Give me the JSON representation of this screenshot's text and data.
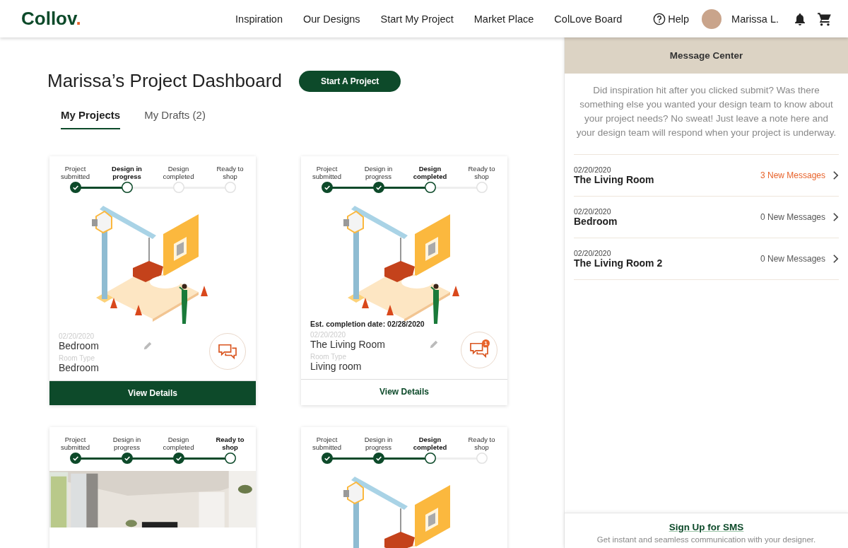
{
  "header": {
    "logo": {
      "text": "Collov",
      "dot": "."
    },
    "nav": [
      "Inspiration",
      "Our Designs",
      "Start My Project",
      "Market Place",
      "ColLove Board"
    ],
    "help": "Help",
    "user": "Marissa L."
  },
  "dashboard": {
    "title": "Marissa’s Project Dashboard",
    "start_button": "Start A Project",
    "tabs": [
      {
        "label": "My Projects",
        "selected": true
      },
      {
        "label": "My Drafts (2)",
        "selected": false
      }
    ],
    "projects": [
      {
        "steps": [
          {
            "label": "Project submitted",
            "done": true,
            "current": false
          },
          {
            "label": "Design in progress",
            "done": false,
            "current": true
          },
          {
            "label": "Design completed",
            "done": false,
            "current": false
          },
          {
            "label": "Ready to shop",
            "done": false,
            "current": false
          }
        ],
        "image": {
          "kind": "illustration"
        },
        "date": "02/20/2020",
        "name": "Bedroom",
        "type_label": "Room Type",
        "room_type": "Bedroom",
        "button": "View Details",
        "hovered": true
      },
      {
        "steps": [
          {
            "label": "Project submitted",
            "done": true,
            "current": false
          },
          {
            "label": "Design in progress",
            "done": true,
            "current": false
          },
          {
            "label": "Design completed",
            "done": false,
            "current": true
          },
          {
            "label": "Ready to shop",
            "done": false,
            "current": false
          }
        ],
        "image": {
          "kind": "illustration"
        },
        "estimate": "Est. completion date: 02/28/2020",
        "date": "02/20/2020",
        "name": "The Living Room",
        "type_label": "Room Type",
        "room_type": "Living room",
        "badge": "1",
        "button": "View Details",
        "hovered": false
      },
      {
        "steps": [
          {
            "label": "Project submitted",
            "done": true,
            "current": false
          },
          {
            "label": "Design in progress",
            "done": true,
            "current": false
          },
          {
            "label": "Design completed",
            "done": true,
            "current": false
          },
          {
            "label": "Ready to shop",
            "done": false,
            "current": true
          }
        ],
        "image": {
          "kind": "picture"
        }
      },
      {
        "steps": [
          {
            "label": "Project submitted",
            "done": true,
            "current": false
          },
          {
            "label": "Design in progress",
            "done": true,
            "current": false
          },
          {
            "label": "Design completed",
            "done": false,
            "current": true
          },
          {
            "label": "Ready to shop",
            "done": false,
            "current": false
          }
        ],
        "image": {
          "kind": "illustration"
        }
      }
    ]
  },
  "message_center": {
    "title": "Message Center",
    "intro": "Did inspiration hit after you clicked submit? Was there something else you wanted your design team to know about your project needs? No sweat! Just leave a note here and your design team will respond when your project is underway.",
    "threads": [
      {
        "date": "02/20/2020",
        "name": "The Living Room",
        "count": "3 New Messages",
        "unread": true
      },
      {
        "date": "02/20/2020",
        "name": "Bedroom",
        "count": "0 New Messages",
        "unread": false
      },
      {
        "date": "02/20/2020",
        "name": "The Living Room 2",
        "count": "0 New Messages",
        "unread": false
      }
    ],
    "sms_link": "Sign Up for SMS",
    "sms_text": "Get instant and seamless communication with your designer."
  }
}
